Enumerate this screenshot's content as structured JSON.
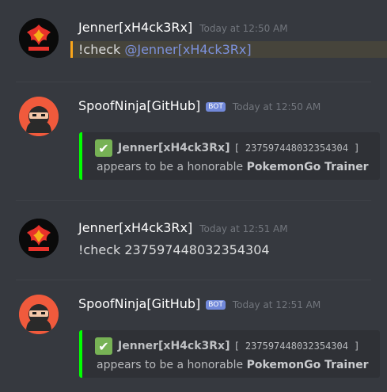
{
  "messages": [
    {
      "username": "Jenner[xH4ck3Rx]",
      "timestamp": "Today at 12:50 AM",
      "text_prefix": "!check ",
      "mention": "@Jenner[xH4ck3Rx]",
      "avatar_text": "TEAM VALOR"
    },
    {
      "username": "SpoofNinja[GitHub]",
      "bot_tag": "BOT",
      "timestamp": "Today at 12:50 AM",
      "embed": {
        "check_icon": "✔",
        "name": "Jenner[xH4ck3Rx]",
        "id_text": "[ 237597448032354304 ]",
        "line2_prefix": "appears to be a honorable ",
        "line2_bold": "PokemonGo Trainer"
      }
    },
    {
      "username": "Jenner[xH4ck3Rx]",
      "timestamp": "Today at 12:51 AM",
      "text": "!check 237597448032354304",
      "avatar_text": "TEAM VALOR"
    },
    {
      "username": "SpoofNinja[GitHub]",
      "bot_tag": "BOT",
      "timestamp": "Today at 12:51 AM",
      "embed": {
        "check_icon": "✔",
        "name": "Jenner[xH4ck3Rx]",
        "id_text": "[ 237597448032354304 ]",
        "line2_prefix": "appears to be a honorable ",
        "line2_bold": "PokemonGo Trainer"
      }
    }
  ],
  "colors": {
    "background": "#36393f",
    "embed_bar": "#00ff00",
    "mention": "#7c91db",
    "bot_tag": "#7289da",
    "highlight": "#faa61a"
  },
  "icons": {
    "valor": "team-valor-logo",
    "ninja": "ninja-avatar",
    "check": "white-check-mark"
  }
}
